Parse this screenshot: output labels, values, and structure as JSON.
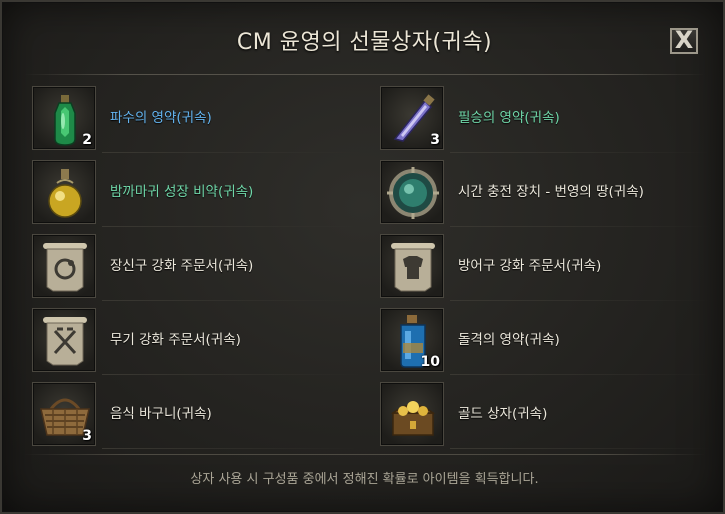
{
  "dialog": {
    "title": "CM 윤영의 선물상자(귀속)",
    "close_label": "X",
    "notice": "상자 사용 시 구성품 중에서 정해진 확률로 아이템을 획득합니다."
  },
  "colors": {
    "name_blue": "#64b4ef",
    "name_green": "#6fd6a8",
    "name_white": "#ece8dc"
  },
  "items": [
    {
      "name": "파수의 영약(귀속)",
      "qty": "2",
      "icon": "green-potion-icon",
      "color": "#64b4ef"
    },
    {
      "name": "필승의 영약(귀속)",
      "qty": "3",
      "icon": "crystal-vial-icon",
      "color": "#6fd6a8"
    },
    {
      "name": "밤까마귀 성장 비약(귀속)",
      "qty": "",
      "icon": "yellow-flask-icon",
      "color": "#6fd6a8"
    },
    {
      "name": "시간 충전 장치 - 번영의 땅(귀속)",
      "qty": "",
      "icon": "time-device-icon",
      "color": "#ece8dc"
    },
    {
      "name": "장신구 강화 주문서(귀속)",
      "qty": "",
      "icon": "accessory-scroll-icon",
      "color": "#ece8dc"
    },
    {
      "name": "방어구 강화 주문서(귀속)",
      "qty": "",
      "icon": "armor-scroll-icon",
      "color": "#ece8dc"
    },
    {
      "name": "무기 강화 주문서(귀속)",
      "qty": "",
      "icon": "weapon-scroll-icon",
      "color": "#ece8dc"
    },
    {
      "name": "돌격의 영약(귀속)",
      "qty": "10",
      "icon": "blue-potion-icon",
      "color": "#ece8dc"
    },
    {
      "name": "음식 바구니(귀속)",
      "qty": "3",
      "icon": "basket-icon",
      "color": "#ece8dc"
    },
    {
      "name": "골드 상자(귀속)",
      "qty": "",
      "icon": "gold-chest-icon",
      "color": "#ece8dc"
    }
  ]
}
